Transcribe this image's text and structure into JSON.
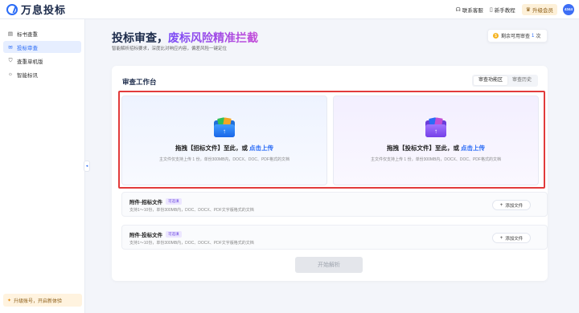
{
  "header": {
    "logo_text": "万息投标",
    "links": [
      {
        "icon": "headset-icon",
        "glyph": "☊",
        "label": "联系客服"
      },
      {
        "icon": "book-icon",
        "glyph": "▯",
        "label": "新手教程"
      }
    ],
    "vip": {
      "icon": "crown-icon",
      "glyph": "♛",
      "label": "升级会员"
    },
    "avatar_text": "4344"
  },
  "sidebar": {
    "items": [
      {
        "icon": "document-icon",
        "glyph": "▤",
        "label": "标书查重",
        "active": false
      },
      {
        "icon": "audit-icon",
        "glyph": "✉",
        "label": "投标审查",
        "active": true
      },
      {
        "icon": "shield-icon",
        "glyph": "⛉",
        "label": "查重单机版",
        "active": false
      },
      {
        "icon": "bulb-icon",
        "glyph": "☼",
        "label": "智能标讯",
        "active": false
      }
    ],
    "upgrade": {
      "glyph": "✦",
      "label": "升级账号，开启新体验"
    },
    "collapse_glyph": "◂"
  },
  "hero": {
    "title_plain": "投标审查，",
    "title_highlight": "废标风险精准拦截",
    "subtitle": "智能解析招标要求，深度比对响应内容，偏差风险一键定位"
  },
  "quota": {
    "prefix": "剩余可用审查",
    "count": "1",
    "unit": "次",
    "glyph": "$"
  },
  "workbench": {
    "title": "审查工作台",
    "tabs": [
      {
        "label": "审查功能区",
        "active": true
      },
      {
        "label": "审查历史",
        "active": false
      }
    ],
    "uploads": [
      {
        "main": "拖拽【招标文件】至此，或 ",
        "link": "点击上传",
        "hint": "主文件仅支持上传 1 份，单份300MB内，DOCX、DOC、PDF格式的文档"
      },
      {
        "main": "拖拽【投标文件】至此，或 ",
        "link": "点击上传",
        "hint": "主文件仅支持上传 1 份，单份300MB内，DOCX、DOC、PDF格式的文档"
      }
    ],
    "attachments": [
      {
        "title": "附件-招标文件",
        "tag": "可选填",
        "hint": "支持1～10份，单份300MB内，DOC、DOCX、PDF文字版格式的文档",
        "button": "添加文件"
      },
      {
        "title": "附件-投标文件",
        "tag": "可选填",
        "hint": "支持1～10份，单份300MB内，DOC、DOCX、PDF文字版格式的文档",
        "button": "添加文件"
      }
    ],
    "start_button": "开始解析"
  },
  "colors": {
    "primary": "#2b6cf6",
    "highlight_border": "#e23b3b",
    "gradient_start": "#7a4cf6",
    "gradient_end": "#c24ad8"
  }
}
